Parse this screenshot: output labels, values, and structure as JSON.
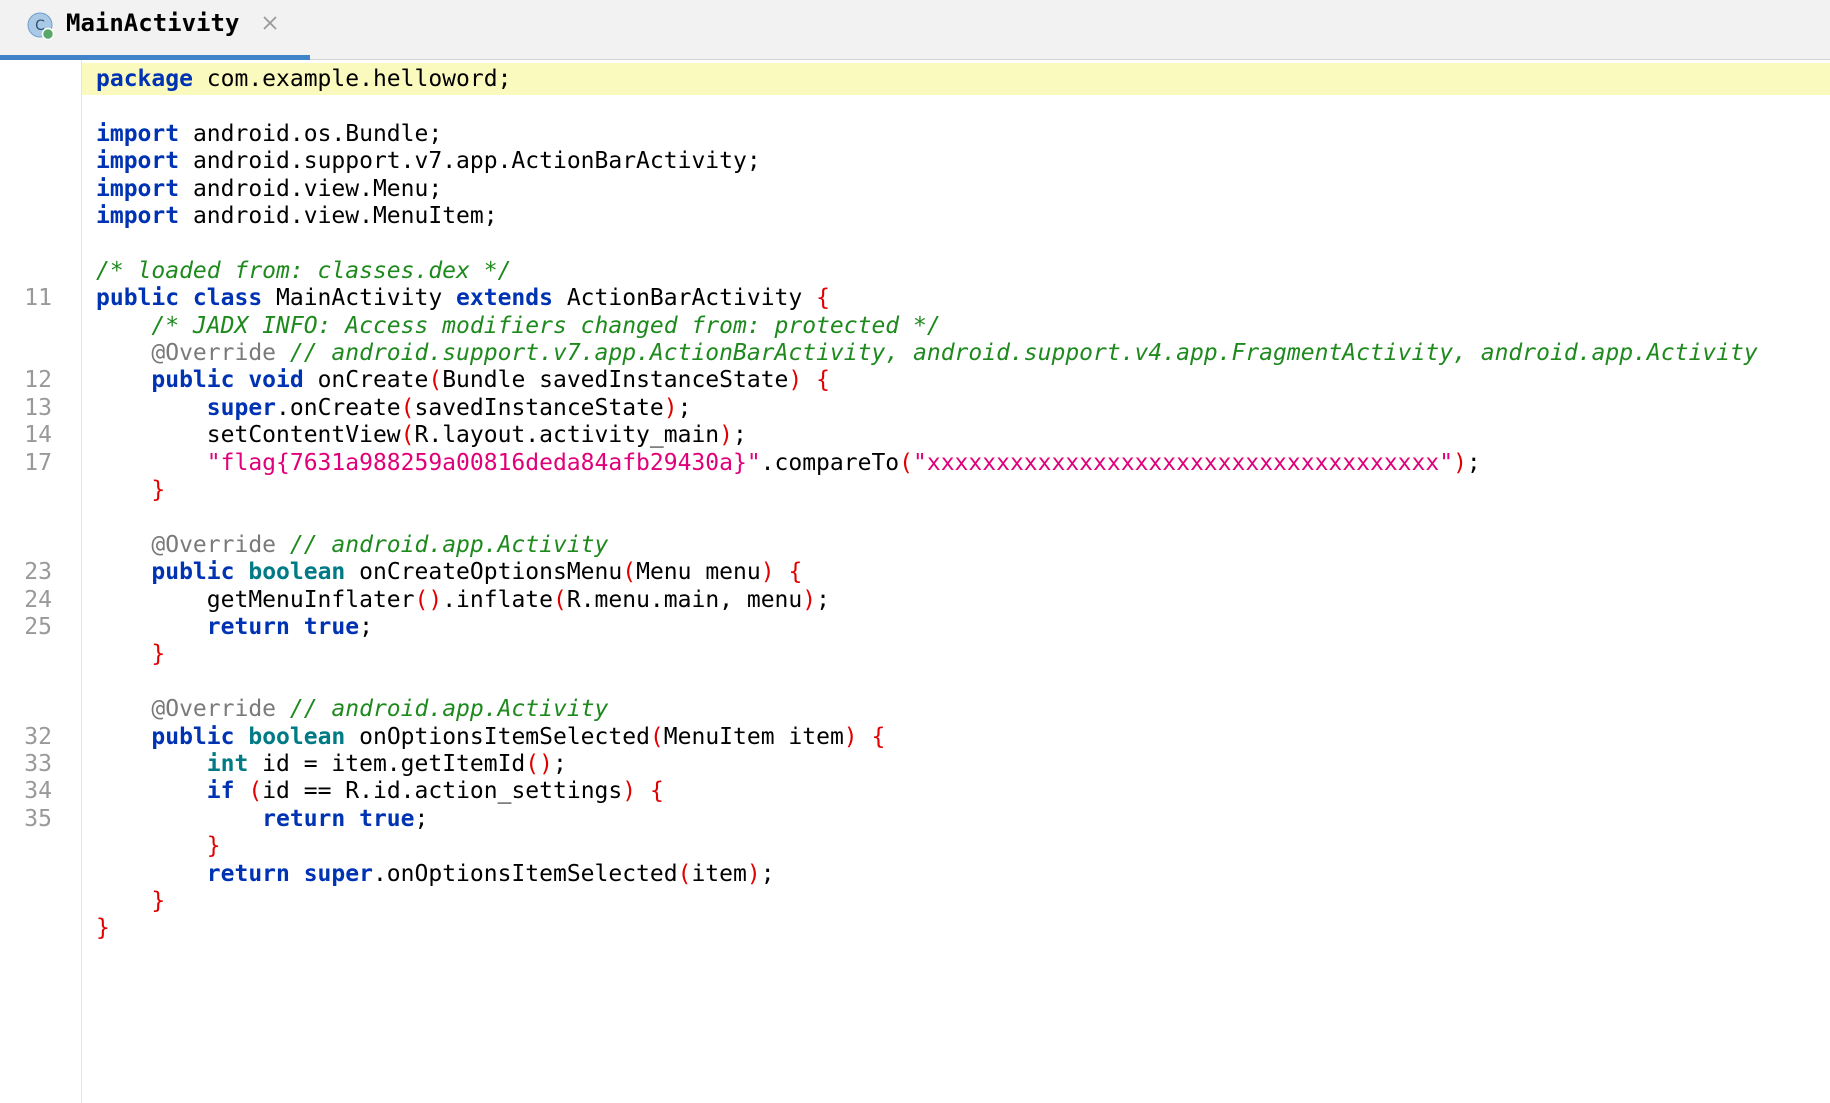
{
  "tab": {
    "title": "MainActivity",
    "icon": "class-icon",
    "icon_letter": "C",
    "close_icon": "close-icon",
    "accent": "#4083c9"
  },
  "gutter": {
    "line_numbers": [
      "",
      "",
      "",
      "",
      "",
      "",
      "",
      "",
      "11",
      "",
      "",
      "12",
      "13",
      "14",
      "17",
      "",
      "",
      "",
      "23",
      "24",
      "25",
      "",
      "",
      "",
      "32",
      "33",
      "34",
      "35",
      "",
      "",
      "",
      ""
    ]
  },
  "code": {
    "highlighted_line_color": "#fafabe",
    "lines": [
      [
        {
          "t": "k",
          "v": "package"
        },
        {
          "t": "n",
          "v": " com.example.helloword;"
        }
      ],
      [],
      [
        {
          "t": "k",
          "v": "import"
        },
        {
          "t": "n",
          "v": " android.os.Bundle;"
        }
      ],
      [
        {
          "t": "k",
          "v": "import"
        },
        {
          "t": "n",
          "v": " android.support.v7.app.ActionBarActivity;"
        }
      ],
      [
        {
          "t": "k",
          "v": "import"
        },
        {
          "t": "n",
          "v": " android.view.Menu;"
        }
      ],
      [
        {
          "t": "k",
          "v": "import"
        },
        {
          "t": "n",
          "v": " android.view.MenuItem;"
        }
      ],
      [],
      [
        {
          "t": "c",
          "v": "/* loaded from: classes.dex */"
        }
      ],
      [
        {
          "t": "k",
          "v": "public class"
        },
        {
          "t": "n",
          "v": " MainActivity "
        },
        {
          "t": "k",
          "v": "extends"
        },
        {
          "t": "n",
          "v": " ActionBarActivity "
        },
        {
          "t": "p",
          "v": "{"
        }
      ],
      [
        {
          "t": "n",
          "v": "    "
        },
        {
          "t": "c",
          "v": "/* JADX INFO: Access modifiers changed from: protected */"
        }
      ],
      [
        {
          "t": "n",
          "v": "    "
        },
        {
          "t": "a",
          "v": "@Override"
        },
        {
          "t": "n",
          "v": " "
        },
        {
          "t": "c",
          "v": "// android.support.v7.app.ActionBarActivity, android.support.v4.app.FragmentActivity, android.app.Activity"
        }
      ],
      [
        {
          "t": "n",
          "v": "    "
        },
        {
          "t": "k",
          "v": "public void"
        },
        {
          "t": "n",
          "v": " onCreate"
        },
        {
          "t": "p",
          "v": "("
        },
        {
          "t": "n",
          "v": "Bundle savedInstanceState"
        },
        {
          "t": "p",
          "v": ")"
        },
        {
          "t": "n",
          "v": " "
        },
        {
          "t": "p",
          "v": "{"
        }
      ],
      [
        {
          "t": "n",
          "v": "        "
        },
        {
          "t": "k",
          "v": "super"
        },
        {
          "t": "n",
          "v": ".onCreate"
        },
        {
          "t": "p",
          "v": "("
        },
        {
          "t": "n",
          "v": "savedInstanceState"
        },
        {
          "t": "p",
          "v": ")"
        },
        {
          "t": "n",
          "v": ";"
        }
      ],
      [
        {
          "t": "n",
          "v": "        setContentView"
        },
        {
          "t": "p",
          "v": "("
        },
        {
          "t": "n",
          "v": "R.layout.activity_main"
        },
        {
          "t": "p",
          "v": ")"
        },
        {
          "t": "n",
          "v": ";"
        }
      ],
      [
        {
          "t": "n",
          "v": "        "
        },
        {
          "t": "s",
          "v": "\"flag{7631a988259a00816deda84afb29430a}\""
        },
        {
          "t": "n",
          "v": ".compareTo"
        },
        {
          "t": "p",
          "v": "("
        },
        {
          "t": "s",
          "v": "\"xxxxxxxxxxxxxxxxxxxxxxxxxxxxxxxxxxxxx\""
        },
        {
          "t": "p",
          "v": ")"
        },
        {
          "t": "n",
          "v": ";"
        }
      ],
      [
        {
          "t": "n",
          "v": "    "
        },
        {
          "t": "p",
          "v": "}"
        }
      ],
      [],
      [
        {
          "t": "n",
          "v": "    "
        },
        {
          "t": "a",
          "v": "@Override"
        },
        {
          "t": "n",
          "v": " "
        },
        {
          "t": "c",
          "v": "// android.app.Activity"
        }
      ],
      [
        {
          "t": "n",
          "v": "    "
        },
        {
          "t": "k",
          "v": "public"
        },
        {
          "t": "n",
          "v": " "
        },
        {
          "t": "kt",
          "v": "boolean"
        },
        {
          "t": "n",
          "v": " onCreateOptionsMenu"
        },
        {
          "t": "p",
          "v": "("
        },
        {
          "t": "n",
          "v": "Menu menu"
        },
        {
          "t": "p",
          "v": ")"
        },
        {
          "t": "n",
          "v": " "
        },
        {
          "t": "p",
          "v": "{"
        }
      ],
      [
        {
          "t": "n",
          "v": "        getMenuInflater"
        },
        {
          "t": "p",
          "v": "()"
        },
        {
          "t": "n",
          "v": ".inflate"
        },
        {
          "t": "p",
          "v": "("
        },
        {
          "t": "n",
          "v": "R.menu.main, menu"
        },
        {
          "t": "p",
          "v": ")"
        },
        {
          "t": "n",
          "v": ";"
        }
      ],
      [
        {
          "t": "n",
          "v": "        "
        },
        {
          "t": "k",
          "v": "return true"
        },
        {
          "t": "n",
          "v": ";"
        }
      ],
      [
        {
          "t": "n",
          "v": "    "
        },
        {
          "t": "p",
          "v": "}"
        }
      ],
      [],
      [
        {
          "t": "n",
          "v": "    "
        },
        {
          "t": "a",
          "v": "@Override"
        },
        {
          "t": "n",
          "v": " "
        },
        {
          "t": "c",
          "v": "// android.app.Activity"
        }
      ],
      [
        {
          "t": "n",
          "v": "    "
        },
        {
          "t": "k",
          "v": "public"
        },
        {
          "t": "n",
          "v": " "
        },
        {
          "t": "kt",
          "v": "boolean"
        },
        {
          "t": "n",
          "v": " onOptionsItemSelected"
        },
        {
          "t": "p",
          "v": "("
        },
        {
          "t": "n",
          "v": "MenuItem item"
        },
        {
          "t": "p",
          "v": ")"
        },
        {
          "t": "n",
          "v": " "
        },
        {
          "t": "p",
          "v": "{"
        }
      ],
      [
        {
          "t": "n",
          "v": "        "
        },
        {
          "t": "kt",
          "v": "int"
        },
        {
          "t": "n",
          "v": " id = item.getItemId"
        },
        {
          "t": "p",
          "v": "()"
        },
        {
          "t": "n",
          "v": ";"
        }
      ],
      [
        {
          "t": "n",
          "v": "        "
        },
        {
          "t": "k",
          "v": "if"
        },
        {
          "t": "n",
          "v": " "
        },
        {
          "t": "p",
          "v": "("
        },
        {
          "t": "n",
          "v": "id == R.id.action_settings"
        },
        {
          "t": "p",
          "v": ")"
        },
        {
          "t": "n",
          "v": " "
        },
        {
          "t": "p",
          "v": "{"
        }
      ],
      [
        {
          "t": "n",
          "v": "            "
        },
        {
          "t": "k",
          "v": "return true"
        },
        {
          "t": "n",
          "v": ";"
        }
      ],
      [
        {
          "t": "n",
          "v": "        "
        },
        {
          "t": "p",
          "v": "}"
        }
      ],
      [
        {
          "t": "n",
          "v": "        "
        },
        {
          "t": "k",
          "v": "return super"
        },
        {
          "t": "n",
          "v": ".onOptionsItemSelected"
        },
        {
          "t": "p",
          "v": "("
        },
        {
          "t": "n",
          "v": "item"
        },
        {
          "t": "p",
          "v": ")"
        },
        {
          "t": "n",
          "v": ";"
        }
      ],
      [
        {
          "t": "n",
          "v": "    "
        },
        {
          "t": "p",
          "v": "}"
        }
      ],
      [
        {
          "t": "p",
          "v": "}"
        }
      ]
    ]
  }
}
